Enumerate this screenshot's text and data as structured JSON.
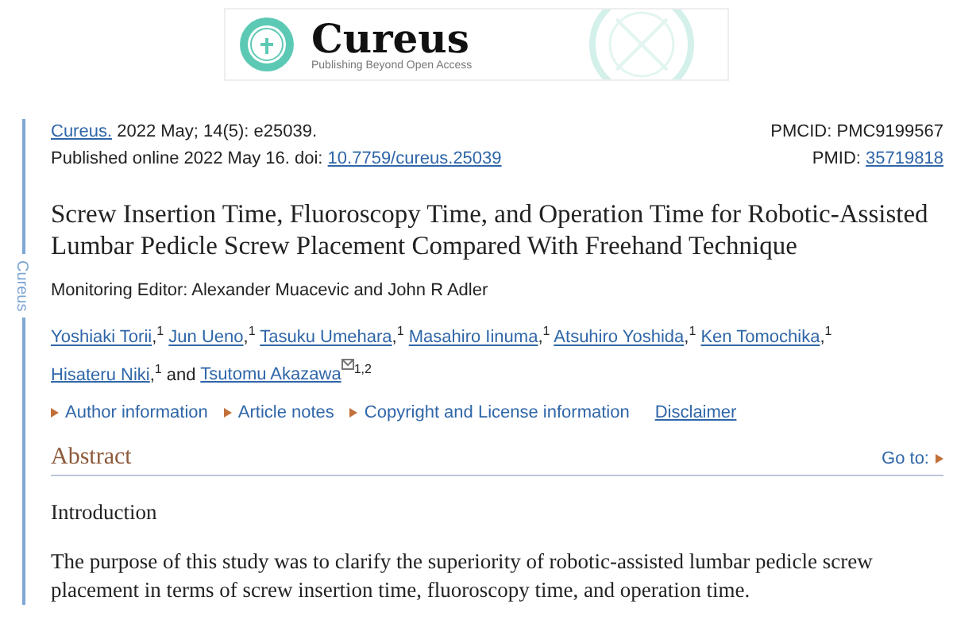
{
  "banner": {
    "logo_text": "Cureus",
    "tagline": "Publishing Beyond Open Access"
  },
  "sidebar_label": "Cureus",
  "citation": {
    "journal": "Cureus.",
    "text": "2022 May; 14(5): e25039."
  },
  "published": {
    "text": "Published online 2022 May 16. doi:",
    "doi": "10.7759/cureus.25039"
  },
  "pmcid": "PMCID: PMC9199567",
  "pmid": {
    "label": "PMID:",
    "value": "35719818"
  },
  "title": "Screw Insertion Time, Fluoroscopy Time, and Operation Time for Robotic-Assisted Lumbar Pedicle Screw Placement Compared With Freehand Technique",
  "monitoring_editor": "Monitoring Editor: Alexander Muacevic and John R Adler",
  "authors": [
    {
      "name": "Yoshiaki Torii",
      "separator": ",",
      "affiliation": "1",
      "corresponding": false
    },
    {
      "name": "Jun Ueno",
      "separator": ",",
      "affiliation": "1",
      "corresponding": false
    },
    {
      "name": "Tasuku Umehara",
      "separator": ",",
      "affiliation": "1",
      "corresponding": false
    },
    {
      "name": "Masahiro Iinuma",
      "separator": ",",
      "affiliation": "1",
      "corresponding": false
    },
    {
      "name": "Atsuhiro Yoshida",
      "separator": ",",
      "affiliation": "1",
      "corresponding": false
    },
    {
      "name": "Ken Tomochika",
      "separator": ",",
      "affiliation": "1",
      "corresponding": false
    },
    {
      "name": "Hisateru Niki",
      "separator": ",",
      "affiliation": "1",
      "corresponding": false
    },
    {
      "name": "Tsutomu Akazawa",
      "affiliation": "1,2",
      "corresponding": true
    }
  ],
  "author_conjunction": "and",
  "info_links": [
    {
      "label": "Author information",
      "kind": "expand"
    },
    {
      "label": "Article notes",
      "kind": "expand"
    },
    {
      "label": "Copyright and License information",
      "kind": "expand"
    },
    {
      "label": "Disclaimer",
      "kind": "link"
    }
  ],
  "abstract": {
    "heading": "Abstract",
    "goto": "Go to:",
    "subheading": "Introduction",
    "paragraph": "The purpose of this study was to clarify the superiority of robotic-assisted lumbar pedicle screw placement in terms of screw insertion time, fluoroscopy time, and operation time."
  }
}
